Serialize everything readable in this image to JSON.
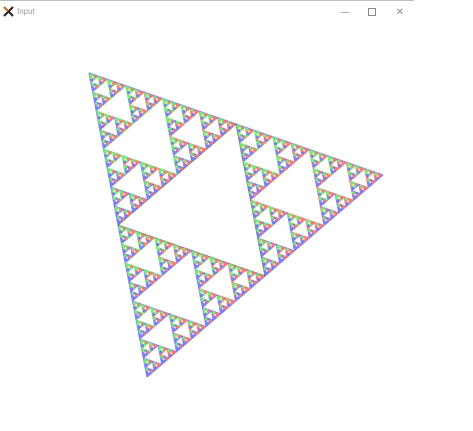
{
  "window": {
    "title": "Input",
    "controls": {
      "minimize": "—",
      "close": "✕"
    }
  },
  "colors": {
    "red": "#ee7777",
    "green": "#77e677",
    "blue": "#7777ee",
    "gray": "#707070"
  }
}
